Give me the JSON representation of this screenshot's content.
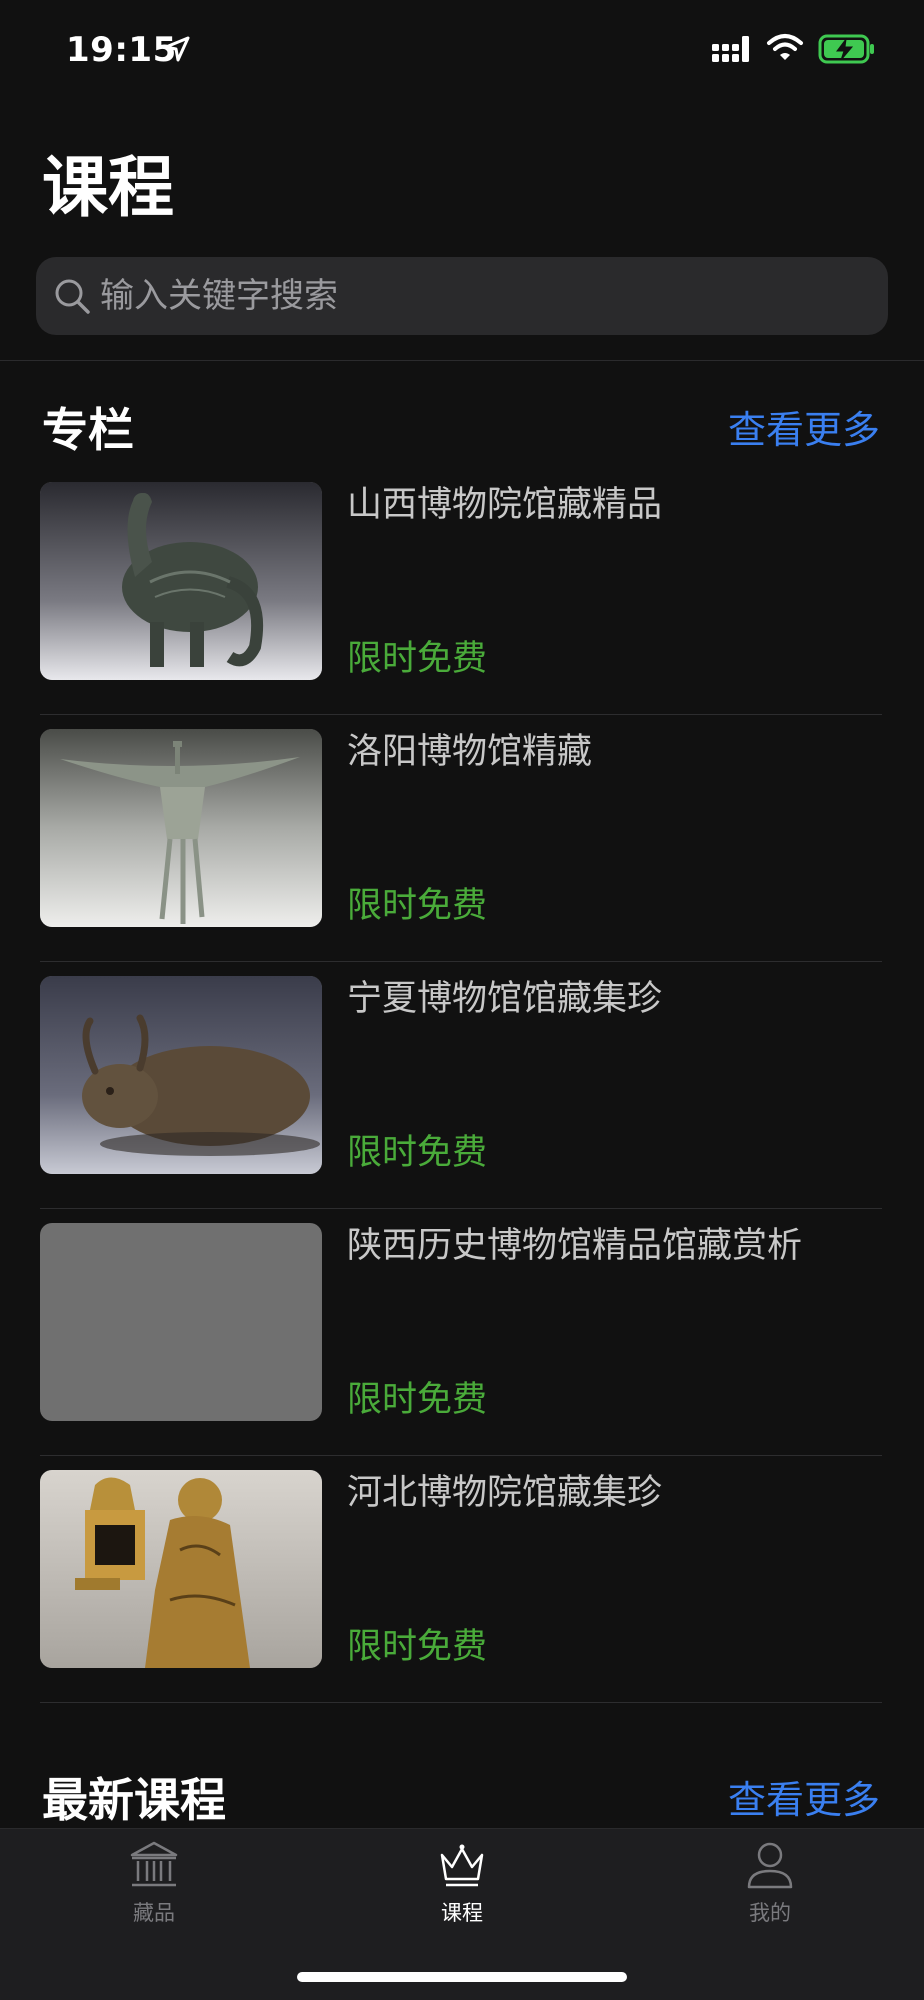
{
  "status_bar": {
    "time": "19:15",
    "icons": [
      "location-arrow-icon",
      "cellular-signal-icon",
      "wifi-icon",
      "battery-charging-icon"
    ],
    "battery_color": "#3fc951"
  },
  "header": {
    "title": "课程",
    "search_placeholder": "输入关键字搜索"
  },
  "sections": {
    "columns": {
      "title": "专栏",
      "see_more": "查看更多"
    },
    "latest": {
      "title": "最新课程",
      "see_more": "查看更多"
    }
  },
  "courses": [
    {
      "title": "山西博物院馆藏精品",
      "price": "限时免费",
      "thumb": "bronze-bird-vessel-image"
    },
    {
      "title": "洛阳博物馆精藏",
      "price": "限时免费",
      "thumb": "bronze-jue-vessel-image"
    },
    {
      "title": "宁夏博物馆馆藏集珍",
      "price": "限时免费",
      "thumb": "bronze-ox-image"
    },
    {
      "title": "陕西历史博物馆精品馆藏赏析",
      "price": "限时免费",
      "thumb": "image-placeholder"
    },
    {
      "title": "河北博物院馆藏集珍",
      "price": "限时免费",
      "thumb": "gilt-lamp-figure-image"
    }
  ],
  "tab_bar": {
    "tabs": [
      {
        "label": "藏品",
        "icon": "museum-icon",
        "active": false
      },
      {
        "label": "课程",
        "icon": "crown-icon",
        "active": true
      },
      {
        "label": "我的",
        "icon": "person-icon",
        "active": false
      }
    ]
  },
  "colors": {
    "background": "#111111",
    "accent_link": "#3a7ff0",
    "price_green": "#4aab3a",
    "tab_bar": "#1e1e20"
  }
}
